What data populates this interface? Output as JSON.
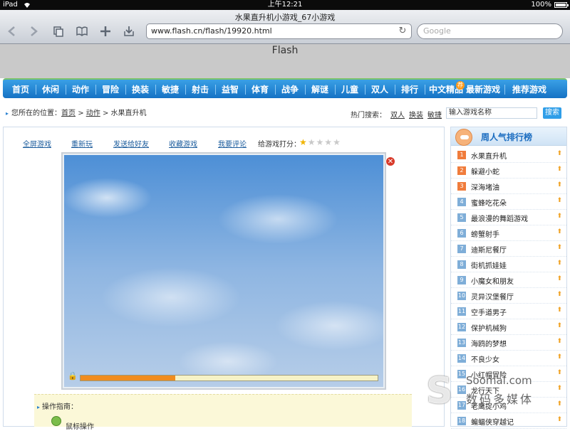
{
  "status": {
    "device": "iPad",
    "time": "上午12:21",
    "battery": "100%"
  },
  "browser": {
    "title": "水果直升机小游戏_67小游戏",
    "url": "www.flash.cn/flash/19920.html",
    "search_placeholder": "Google",
    "icons": [
      "back-arrow-icon",
      "forward-arrow-icon",
      "pages-icon",
      "bookmarks-icon",
      "add-icon",
      "download-icon",
      "reload-icon"
    ]
  },
  "flash_banner": "Flash",
  "nav": {
    "items": [
      "首页",
      "休闲",
      "动作",
      "冒险",
      "换装",
      "敏捷",
      "射击",
      "益智",
      "体育",
      "战争",
      "解谜",
      "儿童",
      "双人",
      "排行",
      "中文精品",
      "最新游戏",
      "推荐游戏"
    ],
    "badge": "荐"
  },
  "breadcrumb": {
    "prefix": "您所在的位置：",
    "home": "首页",
    "category": "动作",
    "current": "水果直升机"
  },
  "hot_search": {
    "label": "热门搜索：",
    "links": [
      "双人",
      "换装",
      "敏捷"
    ],
    "input_placeholder": "输入游戏名称",
    "button": "搜索"
  },
  "game_actions": [
    "全屏游戏",
    "重新玩",
    "发送给好友",
    "收藏游戏",
    "我要评论"
  ],
  "rating": {
    "label": "给游戏打分：",
    "value": 1,
    "max": 5
  },
  "game": {
    "loading_progress": 0.32
  },
  "guide": {
    "title": "操作指南：",
    "mouse_label": "鼠标操作"
  },
  "ranking": {
    "title": "周人气排行榜",
    "items": [
      {
        "num": "1",
        "name": "水果直升机"
      },
      {
        "num": "2",
        "name": "躲避小蛇"
      },
      {
        "num": "3",
        "name": "深海堵油"
      },
      {
        "num": "4",
        "name": "蜜蜂吃花朵"
      },
      {
        "num": "5",
        "name": "最浪漫的舞蹈游戏"
      },
      {
        "num": "6",
        "name": "螃蟹射手"
      },
      {
        "num": "7",
        "name": "迪斯尼餐厅"
      },
      {
        "num": "8",
        "name": "街机抓娃娃"
      },
      {
        "num": "9",
        "name": "小魔女和朋友"
      },
      {
        "num": "10",
        "name": "灵异汉堡餐厅"
      },
      {
        "num": "11",
        "name": "空手道男子"
      },
      {
        "num": "12",
        "name": "保护机械狗"
      },
      {
        "num": "13",
        "name": "海鸥的梦想"
      },
      {
        "num": "14",
        "name": "不良少女"
      },
      {
        "num": "15",
        "name": "小红帽冒险"
      },
      {
        "num": "16",
        "name": "龙行天下"
      },
      {
        "num": "17",
        "name": "老鹰捉小鸡"
      },
      {
        "num": "18",
        "name": "蝙蝠侠穿越记"
      }
    ]
  },
  "watermark": {
    "domain": "Soomal.com",
    "text": "数码多媒体"
  }
}
